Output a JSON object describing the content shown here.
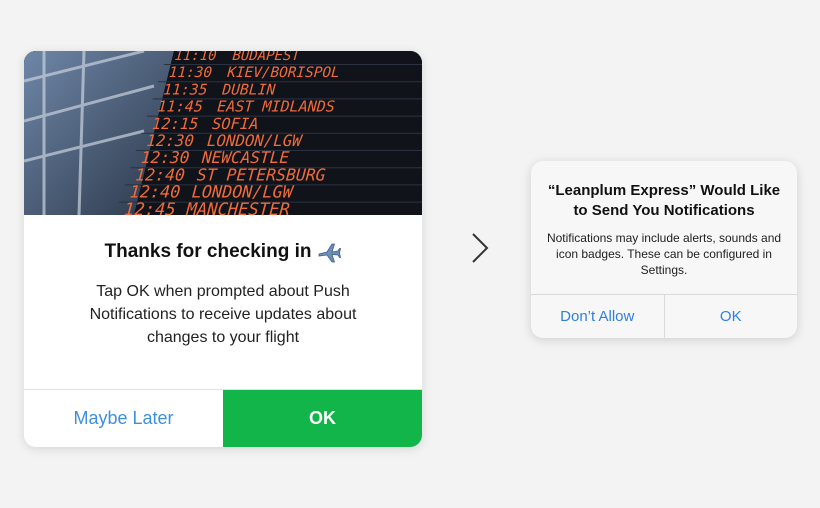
{
  "card": {
    "board_rows": [
      {
        "time": "11:10",
        "destination": "BUDAPEST"
      },
      {
        "time": "11:30",
        "destination": "KIEV/BORISPOL"
      },
      {
        "time": "11:35",
        "destination": "DUBLIN"
      },
      {
        "time": "11:45",
        "destination": "EAST MIDLANDS"
      },
      {
        "time": "12:15",
        "destination": "SOFIA"
      },
      {
        "time": "12:30",
        "destination": "LONDON/LGW"
      },
      {
        "time": "12:30",
        "destination": "NEWCASTLE"
      },
      {
        "time": "12:40",
        "destination": "ST PETERSBURG"
      },
      {
        "time": "12:40",
        "destination": "LONDON/LGW"
      },
      {
        "time": "12:45",
        "destination": "MANCHESTER"
      }
    ],
    "title": "Thanks for checking in",
    "title_icon": "airplane-icon",
    "body": "Tap OK when prompted about Push Notifications to receive updates about changes to your flight",
    "later_label": "Maybe Later",
    "ok_label": "OK",
    "colors": {
      "ok_bg": "#12b54a",
      "later_text": "#3f8fe0",
      "board_text": "#f06a3a"
    }
  },
  "arrow_icon": "chevron-right-icon",
  "dialog": {
    "title": "“Leanplum Express” Would Like to Send You Notifications",
    "message": "Notifications may include alerts, sounds and icon badges. These can be configured in Settings.",
    "dont_allow_label": "Don’t Allow",
    "ok_label": "OK",
    "colors": {
      "button_text": "#2f7fe0"
    }
  }
}
